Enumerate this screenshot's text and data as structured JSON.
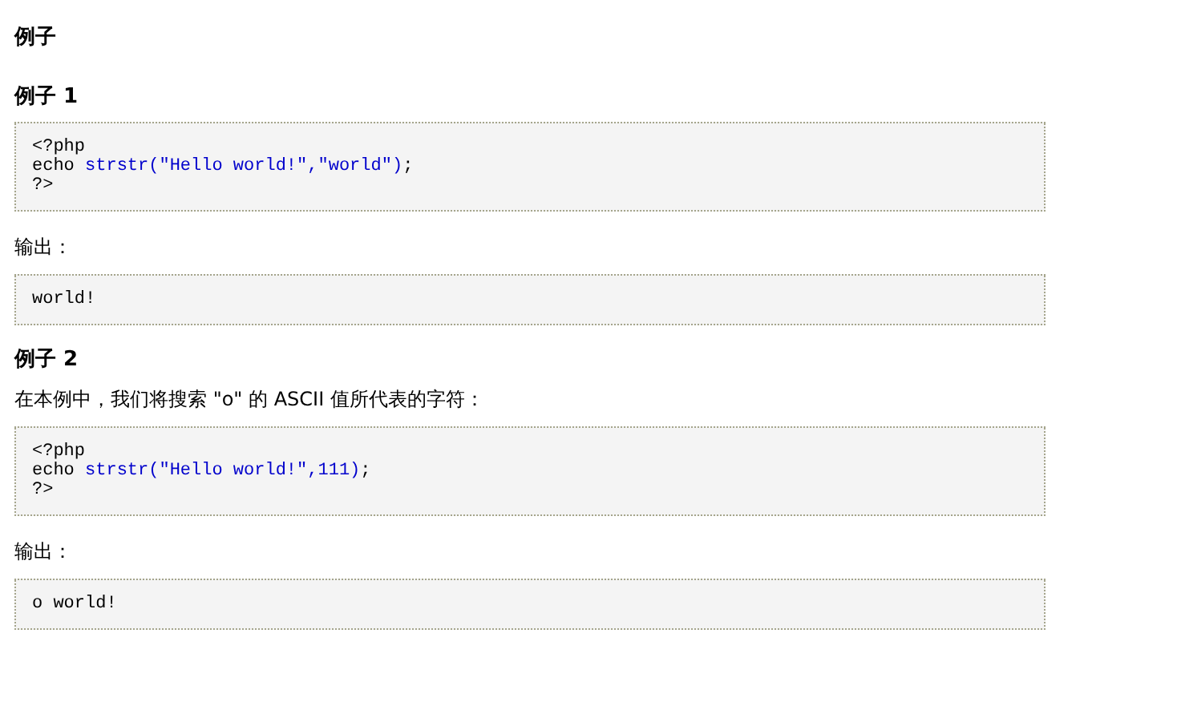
{
  "title": "例子",
  "sections": [
    {
      "kind": "heading",
      "text": "例子 1"
    },
    {
      "kind": "code",
      "lines": [
        [
          {
            "text": "<?php",
            "kind": "plain"
          }
        ],
        [
          {
            "text": "echo ",
            "kind": "plain"
          },
          {
            "text": "strstr(\"Hello world!\",\"world\")",
            "kind": "func"
          },
          {
            "text": ";",
            "kind": "plain"
          }
        ],
        [
          {
            "text": "?>",
            "kind": "plain"
          }
        ]
      ]
    },
    {
      "kind": "para",
      "text": "输出："
    },
    {
      "kind": "code",
      "lines": [
        [
          {
            "text": "world!",
            "kind": "plain"
          }
        ]
      ]
    },
    {
      "kind": "heading",
      "text": "例子 2"
    },
    {
      "kind": "para",
      "text": "在本例中，我们将搜索 \"o\" 的 ASCII 值所代表的字符："
    },
    {
      "kind": "code",
      "lines": [
        [
          {
            "text": "<?php",
            "kind": "plain"
          }
        ],
        [
          {
            "text": "echo ",
            "kind": "plain"
          },
          {
            "text": "strstr(\"Hello world!\",111)",
            "kind": "func"
          },
          {
            "text": ";",
            "kind": "plain"
          }
        ],
        [
          {
            "text": "?>",
            "kind": "plain"
          }
        ]
      ]
    },
    {
      "kind": "para",
      "text": "输出："
    },
    {
      "kind": "code",
      "lines": [
        [
          {
            "text": "o world!",
            "kind": "plain"
          }
        ]
      ]
    }
  ]
}
